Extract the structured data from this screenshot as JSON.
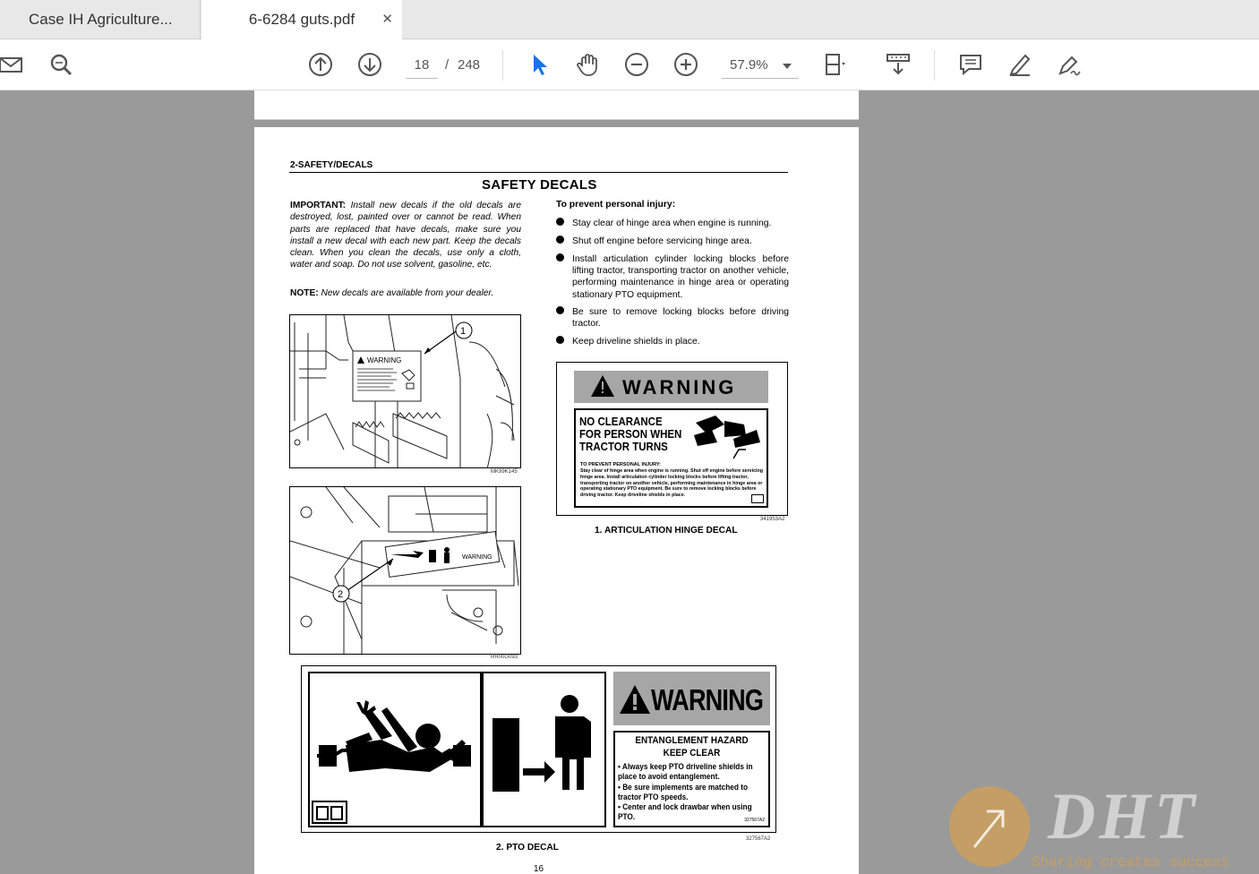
{
  "tabs": [
    {
      "label": "Case IH Agriculture..."
    },
    {
      "label": "6-6284 guts.pdf",
      "close": "✕"
    }
  ],
  "toolbar": {
    "current_page": "18",
    "page_sep": "/",
    "total_pages": "248",
    "zoom": "57.9%"
  },
  "doc": {
    "section_header": "2-SAFETY/DECALS",
    "title": "SAFETY DECALS",
    "important_label": "IMPORTANT:",
    "important_text": " Install new decals if the old decals are destroyed, lost, painted over or cannot be read. When parts are replaced that have decals, make sure you install a new decal with each new part. Keep the decals clean. When you clean the decals, use only a cloth, water and soap. Do not use solvent, gasoline, etc.",
    "note_label": "NOTE:",
    "note_text": " New decals are available from your dealer.",
    "prevent_heading": "To prevent personal injury:",
    "bullets": [
      "Stay clear of hinge area when engine is running.",
      "Shut off engine before servicing hinge area.",
      "Install articulation cylinder locking blocks before lifting tractor, transporting tractor on another vehicle, performing maintenance in hinge area or operating stationary PTO equipment.",
      "Be sure to remove locking blocks before driving tractor.",
      "Keep driveline shields in place."
    ],
    "fig1_callout": "1",
    "fig1_decal": "WARNING",
    "fig1_code": "MK99K145",
    "fig2_callout": "2",
    "fig2_decal": "WARNING",
    "fig2_code": "RR00G093",
    "hinge": {
      "warning": "WARNING",
      "headline": [
        "NO CLEARANCE",
        "FOR PERSON WHEN",
        "TRACTOR TURNS"
      ],
      "sub": "TO PREVENT PERSONAL INJURY:",
      "body": "Stay clear of hinge area when engine is running. Shut off engine before servicing hinge area. Install articulation cylinder locking blocks before lifting tractor, transporting tractor on another vehicle, performing maintenance in hinge area or operating stationary PTO equipment. Be sure to remove locking blocks before driving tractor. Keep driveline shields in place.",
      "code": "341953A2",
      "caption": "1. ARTICULATION HINGE DECAL"
    },
    "pto": {
      "warning": "WARNING",
      "line1": "ENTANGLEMENT HAZARD",
      "line2": "KEEP CLEAR",
      "b1": "• Always keep PTO driveline shields in place to avoid entanglement.",
      "b2": "• Be sure implements are matched to tractor PTO speeds.",
      "b3": "• Center and lock drawbar when using PTO.",
      "inner_code": "327567A2",
      "code": "327567A2",
      "caption": "2. PTO DECAL"
    },
    "page_number": "16"
  },
  "watermark": {
    "brand": "DHT",
    "slogan": "Sharing creates success"
  }
}
